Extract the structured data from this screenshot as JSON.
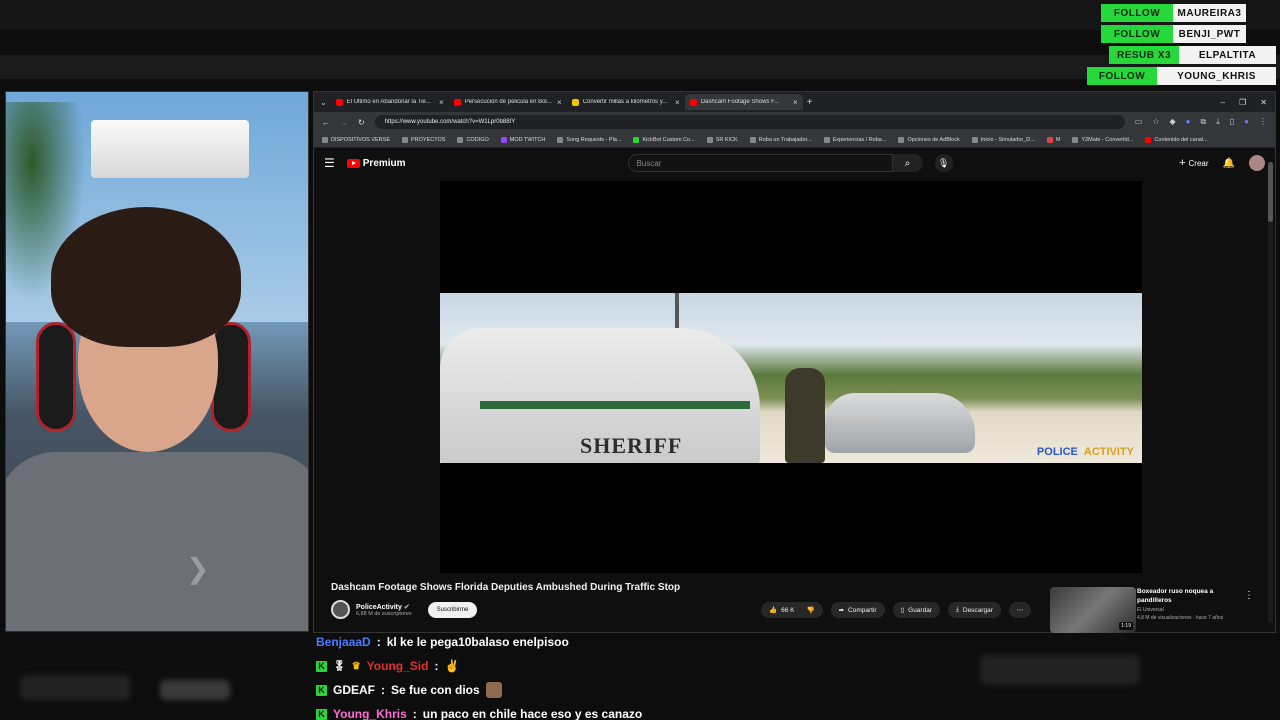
{
  "alerts": [
    {
      "tag": "FOLLOW",
      "name": "MAUREIRA3"
    },
    {
      "tag": "FOLLOW",
      "name": "BENJI_PWT"
    },
    {
      "tag": "RESUB X3",
      "name": "ELPALTITA"
    },
    {
      "tag": "FOLLOW",
      "name": "YOUNG_KHRIS"
    }
  ],
  "browser": {
    "tabs": [
      {
        "label": "El Último en Abandonar la Tie...",
        "favicon": "youtube-icon"
      },
      {
        "label": "Persecucion de pelicula en Bol...",
        "favicon": "youtube-icon"
      },
      {
        "label": "Convertir millas a kilómetros y...",
        "favicon": "converter-icon"
      },
      {
        "label": "Dashcam Footage Shows F...",
        "favicon": "youtube-icon",
        "active": true
      }
    ],
    "url": "https://www.youtube.com/watch?v=W1Lpr0b88IY",
    "bookmarks": [
      "DISPOSITIVOS VERSE",
      "PROYECTOS",
      "CODIGO",
      "MOD TWITCH",
      "Song Requests - Pla...",
      "KickBot Custom Co...",
      "SR KICK",
      "Roba un Trabajador...",
      "Experiencias / Roba...",
      "Opciones de AdBlock",
      "Inicio - Simulador_D...",
      "M",
      "Y2Mate - Convertid...",
      "Contenido del canal..."
    ]
  },
  "youtube": {
    "logo_text": "Premium",
    "search_placeholder": "Buscar",
    "create_label": "Crear",
    "video": {
      "title": "Dashcam Footage Shows Florida Deputies Ambushed During Traffic Stop",
      "channel": "PoliceActivity",
      "subscribers": "6,88 M de suscriptores",
      "subscribe_label": "Suscribirme",
      "likes": "66 K",
      "share_label": "Compartir",
      "save_label": "Guardar",
      "download_label": "Descargar",
      "car_text": "SHERIFF",
      "watermark_1": "POLICE",
      "watermark_2": "ACTIVITY"
    },
    "recommended": {
      "title": "Boxeador ruso noquea a pandilleros",
      "channel": "El Universal",
      "views": "4,8 M de visualizaciones · hace 7 años",
      "duration": "1:19"
    }
  },
  "chat": [
    {
      "user": "BenjaaaD",
      "color": "#4a7bff",
      "message": "kl ke le pega10balaso enelpisoo"
    },
    {
      "user": "Young_Sid",
      "color": "#e03030",
      "message": ""
    },
    {
      "user": "GDEAF",
      "color": "#ffffff",
      "message": "Se fue con dios"
    },
    {
      "user": "Young_Khris",
      "color": "#ff6ad5",
      "message": "un paco en chile hace eso y es canazo"
    }
  ]
}
